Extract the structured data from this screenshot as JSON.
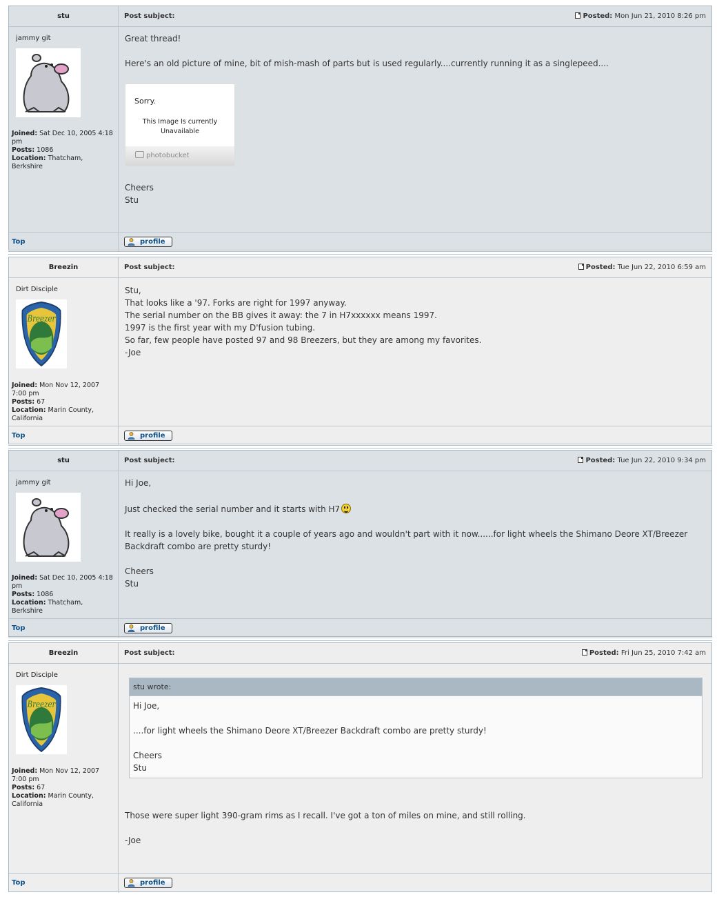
{
  "labels": {
    "post_subject": "Post subject:",
    "posted": "Posted:",
    "joined": "Joined:",
    "posts": "Posts:",
    "location": "Location:",
    "top": "Top",
    "profile": "profile"
  },
  "posts": [
    {
      "author": "stu",
      "rank": "jammy git",
      "avatar": "bear-avatar",
      "joined": "Sat Dec 10, 2005 4:18 pm",
      "post_count": "1086",
      "location": "Thatcham, Berkshire",
      "posted": "Mon Jun 21, 2010 8:26 pm",
      "lines": [
        "Great thread!",
        "Here's an old picture of mine, bit of mish-mash of parts but is used regularly....currently running it as a singlepeed....",
        "Cheers",
        "Stu"
      ],
      "image": {
        "sorry": "Sorry.",
        "message_line1": "This Image Is currently",
        "message_line2": "Unavailable",
        "brand": "photobucket"
      }
    },
    {
      "author": "Breezin",
      "rank": "Dirt Disciple",
      "avatar": "breezer-badge-avatar",
      "joined": "Mon Nov 12, 2007 7:00 pm",
      "post_count": "67",
      "location": "Marin County, California",
      "posted": "Tue Jun 22, 2010 6:59 am",
      "lines": [
        "Stu,",
        "That looks like a '97. Forks are right for 1997 anyway.",
        "The serial number on the BB gives it away: the 7 in H7xxxxxx means 1997.",
        "1997 is the first year with my D'fusion tubing.",
        "So far, few people have posted 97 and 98 Breezers, but they are among my favorites.",
        "-Joe"
      ]
    },
    {
      "author": "stu",
      "rank": "jammy git",
      "avatar": "bear-avatar",
      "joined": "Sat Dec 10, 2005 4:18 pm",
      "post_count": "1086",
      "location": "Thatcham, Berkshire",
      "posted": "Tue Jun 22, 2010 9:34 pm",
      "lines": [
        "Hi Joe,",
        "Just checked the serial number and it starts with H7",
        "It really is a lovely bike, bought it a couple of years ago and wouldn't part with it now......for light wheels the Shimano Deore XT/Breezer",
        "Backdraft combo are pretty sturdy!",
        "Cheers",
        "Stu"
      ]
    },
    {
      "author": "Breezin",
      "rank": "Dirt Disciple",
      "avatar": "breezer-badge-avatar",
      "joined": "Mon Nov 12, 2007 7:00 pm",
      "post_count": "67",
      "location": "Marin County, California",
      "posted": "Fri Jun 25, 2010 7:42 am",
      "quote": {
        "header": "stu wrote:",
        "lines": [
          "Hi Joe,",
          "....for light wheels the Shimano Deore XT/Breezer Backdraft combo are pretty sturdy!",
          "Cheers",
          "Stu"
        ]
      },
      "lines": [
        "Those were super light 390-gram rims as I recall. I've got a ton of miles on mine, and still rolling.",
        "-Joe"
      ]
    }
  ]
}
